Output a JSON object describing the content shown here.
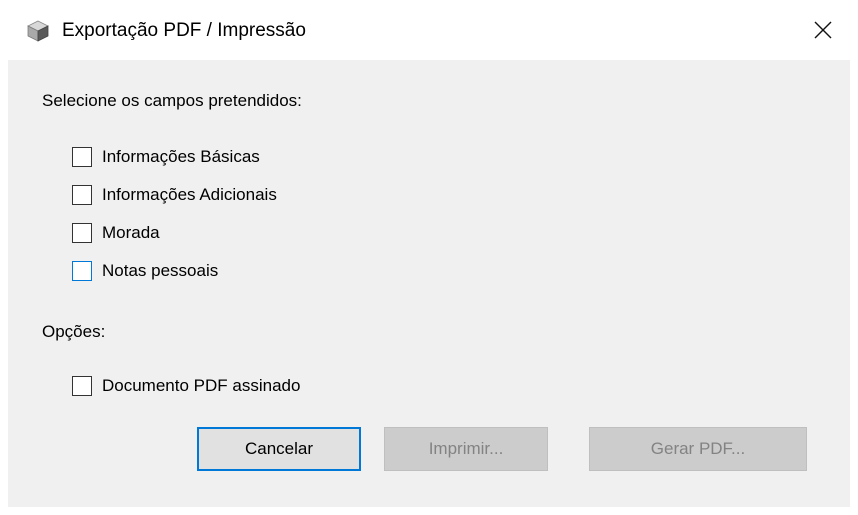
{
  "window": {
    "title": "Exportação PDF / Impressão",
    "app_icon": "cube-icon",
    "close_icon": "close-icon"
  },
  "fields_section": {
    "label": "Selecione os campos pretendidos:",
    "checkboxes": [
      {
        "label": "Informações Básicas",
        "checked": false
      },
      {
        "label": "Informações Adicionais",
        "checked": false
      },
      {
        "label": "Morada",
        "checked": false
      },
      {
        "label": "Notas pessoais",
        "checked": false,
        "focused": true
      }
    ]
  },
  "options_section": {
    "label": "Opções:",
    "checkboxes": [
      {
        "label": "Documento PDF assinado",
        "checked": false
      }
    ]
  },
  "buttons": {
    "cancel": "Cancelar",
    "print": "Imprimir...",
    "generate_pdf": "Gerar PDF..."
  },
  "colors": {
    "accent": "#0078d7",
    "client_background": "#f0f0f0",
    "disabled_button": "#cccccc",
    "disabled_text": "#838383"
  }
}
